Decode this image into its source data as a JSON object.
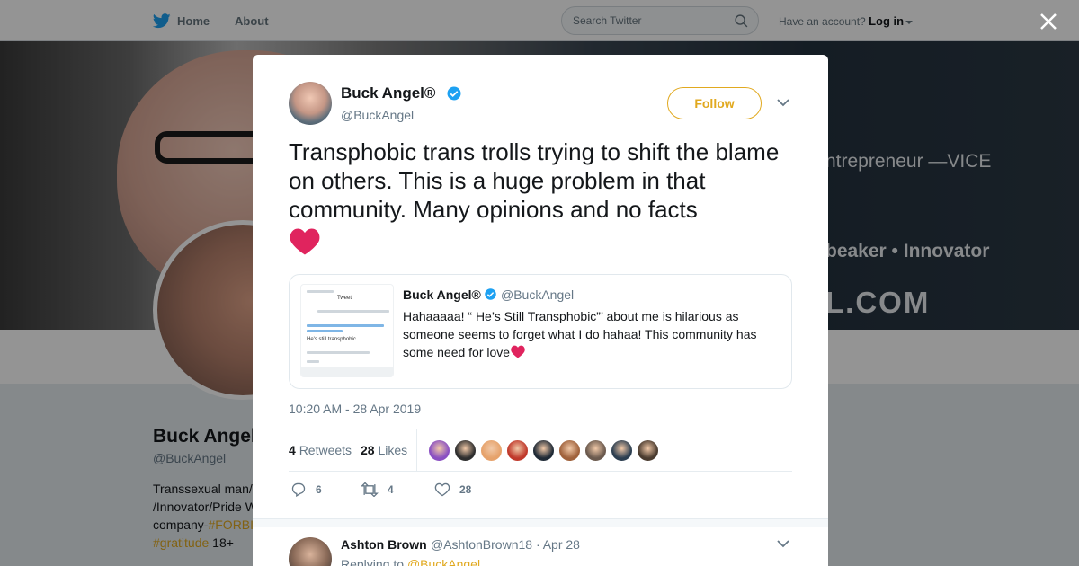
{
  "nav": {
    "home_label": "Home",
    "about_label": "About",
    "search_placeholder": "Search Twitter",
    "account_prompt": "Have an account?",
    "login_label": "Log in"
  },
  "colors": {
    "accent": "#e1a91f",
    "brand": "#1da1f2",
    "heart": "#e0245e"
  },
  "banner": {
    "line0": "",
    "line1": "ntrepreneur —VICE",
    "line2": "beaker • Innovator",
    "line3": "L.COM"
  },
  "profile": {
    "name": "Buck Angel",
    "handle": "@BuckAngel",
    "bio_line1": "Transsexual man/",
    "bio_line2": "/Innovator/Pride W",
    "bio_line3_prefix": "company-",
    "bio_line3_tag": "#FORBI",
    "bio_line4_tag": "#gratitude",
    "bio_line4_suffix": " 18+"
  },
  "tweet": {
    "author_name": "Buck Angel®",
    "author_handle": "@BuckAngel",
    "follow_label": "Follow",
    "text": "Transphobic trans trolls trying to shift the blame on others. This is a huge problem in that community. Many opinions and no facts",
    "timestamp": "10:20 AM - 28 Apr 2019",
    "retweets_count": "4",
    "retweets_label": "Retweets",
    "likes_count": "28",
    "likes_label": "Likes",
    "reply_count": "6",
    "retweet_count_action": "4",
    "like_count_action": "28",
    "icons": [
      "twitter-bird-icon",
      "search-icon",
      "close-icon",
      "verified-badge-icon",
      "chevron-down-icon",
      "heart-icon",
      "reply-icon",
      "retweet-icon",
      "like-icon"
    ]
  },
  "quoted": {
    "author_name": "Buck Angel®",
    "author_handle": "@BuckAngel",
    "text": "Hahaaaaa! “ He’s Still Transphobic”’ about me is hilarious as someone seems to forget what I do hahaa! This community has some need for love",
    "thumb_title": "Tweet",
    "thumb_line": "He's still transphobic"
  },
  "likers": [
    "#8a4fc2",
    "#2e2e2e",
    "#e6a26b",
    "#c0392b",
    "#1f2a36",
    "#a0623c",
    "#6b5a4e",
    "#2c3e50",
    "#4a3b2f"
  ],
  "reply": {
    "author_name": "Ashton Brown",
    "author_handle": "@AshtonBrown18 · Apr 28",
    "replying_prefix": "Replying to ",
    "replying_mention": "@BuckAngel"
  }
}
